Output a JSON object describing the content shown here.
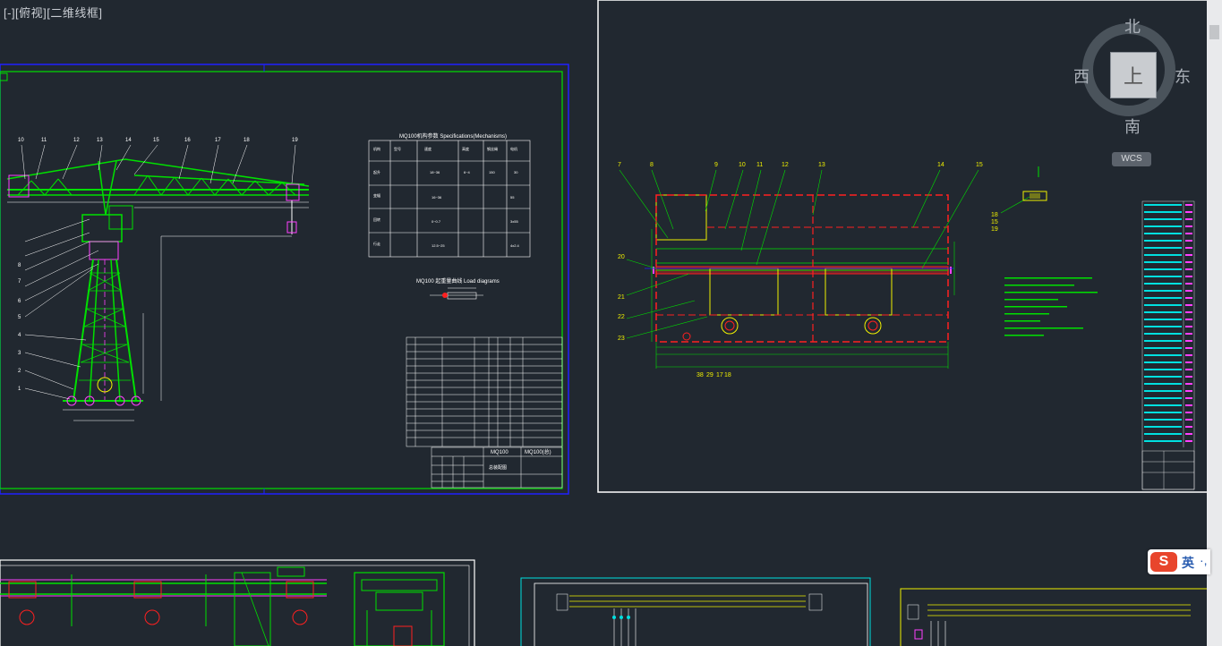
{
  "viewport": {
    "label": "[-][俯视][二维线框]"
  },
  "viewcube": {
    "north": "北",
    "south": "南",
    "east": "东",
    "west": "西",
    "face": "上",
    "wcs_label": "WCS"
  },
  "ime": {
    "logo": "S",
    "lang": "英",
    "punct": "·,"
  },
  "sheet1": {
    "spec_title": "MQ100机构参数 Specifications(Mechanisms)",
    "load_title": "MQ100 起重量曲线 Load diagrams",
    "title_block": [
      "MQ100",
      "MQ100(总)",
      "总装配图"
    ],
    "callouts": [
      "10",
      "11",
      "12",
      "13",
      "14",
      "15",
      "16",
      "17",
      "18",
      "19",
      "1",
      "2",
      "3",
      "4",
      "5",
      "6",
      "7",
      "8"
    ]
  },
  "sheet2": {
    "callouts_top": [
      "7",
      "8",
      "9",
      "10",
      "11",
      "12",
      "13",
      "14",
      "15"
    ],
    "callouts_left": [
      "20",
      "21",
      "22",
      "23"
    ],
    "callouts_bottom": [
      "38",
      "29",
      "17",
      "18"
    ],
    "callouts_right": [
      "18",
      "15",
      "19"
    ]
  },
  "colors": {
    "background": "#212830",
    "green": "#00e000",
    "yellow": "#f0f000",
    "red": "#ff2020",
    "cyan": "#00e0e0",
    "magenta": "#ff40ff",
    "white": "#ffffff",
    "blue": "#2020ff"
  }
}
